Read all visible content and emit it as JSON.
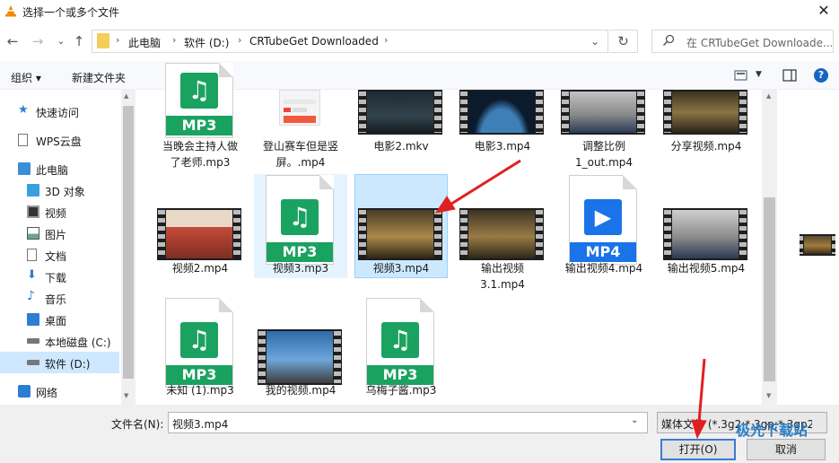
{
  "window": {
    "title": "选择一个或多个文件",
    "close": "✕"
  },
  "nav": {
    "back": "←",
    "forward": "→",
    "recent": "⌄",
    "up": "↑",
    "breadcrumb": [
      "此电脑",
      "软件 (D:)",
      "CRTubeGet Downloaded"
    ],
    "refresh": "↻",
    "search_placeholder": "在 CRTubeGet Downloade..."
  },
  "toolbar": {
    "organize": "组织 ▾",
    "new_folder": "新建文件夹",
    "help": "?"
  },
  "sidebar": [
    {
      "label": "快速访问",
      "icon": "star-icon"
    },
    {
      "label": "WPS云盘",
      "icon": "document-icon"
    },
    {
      "label": "此电脑",
      "icon": "computer-icon"
    },
    {
      "label": "3D 对象",
      "icon": "cube-icon"
    },
    {
      "label": "视频",
      "icon": "film-icon"
    },
    {
      "label": "图片",
      "icon": "picture-icon"
    },
    {
      "label": "文档",
      "icon": "document-icon"
    },
    {
      "label": "下载",
      "icon": "download-icon"
    },
    {
      "label": "音乐",
      "icon": "music-icon"
    },
    {
      "label": "桌面",
      "icon": "desktop-icon"
    },
    {
      "label": "本地磁盘 (C:)",
      "icon": "drive-icon"
    },
    {
      "label": "软件 (D:)",
      "icon": "drive-icon",
      "selected": true
    },
    {
      "label": "网络",
      "icon": "network-icon"
    }
  ],
  "files": [
    {
      "name1": "当晚会主持人做",
      "name2": "了老师.mp3",
      "kind": "mp3"
    },
    {
      "name1": "登山赛车但是竖",
      "name2": "屏。.mp4",
      "kind": "phone"
    },
    {
      "name1": "电影2.mkv",
      "name2": "",
      "kind": "video"
    },
    {
      "name1": "电影3.mp4",
      "name2": "",
      "kind": "video"
    },
    {
      "name1": "调整比例",
      "name2": "1_out.mp4",
      "kind": "video"
    },
    {
      "name1": "分享视频.mp4",
      "name2": "",
      "kind": "video"
    },
    {
      "name1": "视频2.mp4",
      "name2": "",
      "kind": "video"
    },
    {
      "name1": "视频3.mp3",
      "name2": "",
      "kind": "mp3"
    },
    {
      "name1": "视频3.mp4",
      "name2": "",
      "kind": "video"
    },
    {
      "name1": "输出视频",
      "name2": "3.1.mp4",
      "kind": "video"
    },
    {
      "name1": "输出视频4.mp4",
      "name2": "",
      "kind": "mp4"
    },
    {
      "name1": "输出视频5.mp4",
      "name2": "",
      "kind": "video"
    },
    {
      "name1": "未知 (1).mp3",
      "name2": "",
      "kind": "mp3"
    },
    {
      "name1": "我的视频.mp4",
      "name2": "",
      "kind": "video"
    },
    {
      "name1": "乌梅子酱.mp3",
      "name2": "",
      "kind": "mp3"
    }
  ],
  "badges": {
    "mp3": "MP3",
    "mp4": "MP4"
  },
  "bottom": {
    "filename_label": "文件名(N):",
    "filename_value": "视频3.mp4",
    "filter": "媒体文件 (*.3g2;*.3gp;*.3gp2;",
    "open": "打开(O)",
    "cancel": "取消",
    "watermark": "极光下载站"
  },
  "colors": {
    "mp3_green": "#1aa260",
    "mp4_blue": "#1a73e8",
    "selection": "#cce8ff",
    "arrow_red": "#e02020"
  }
}
